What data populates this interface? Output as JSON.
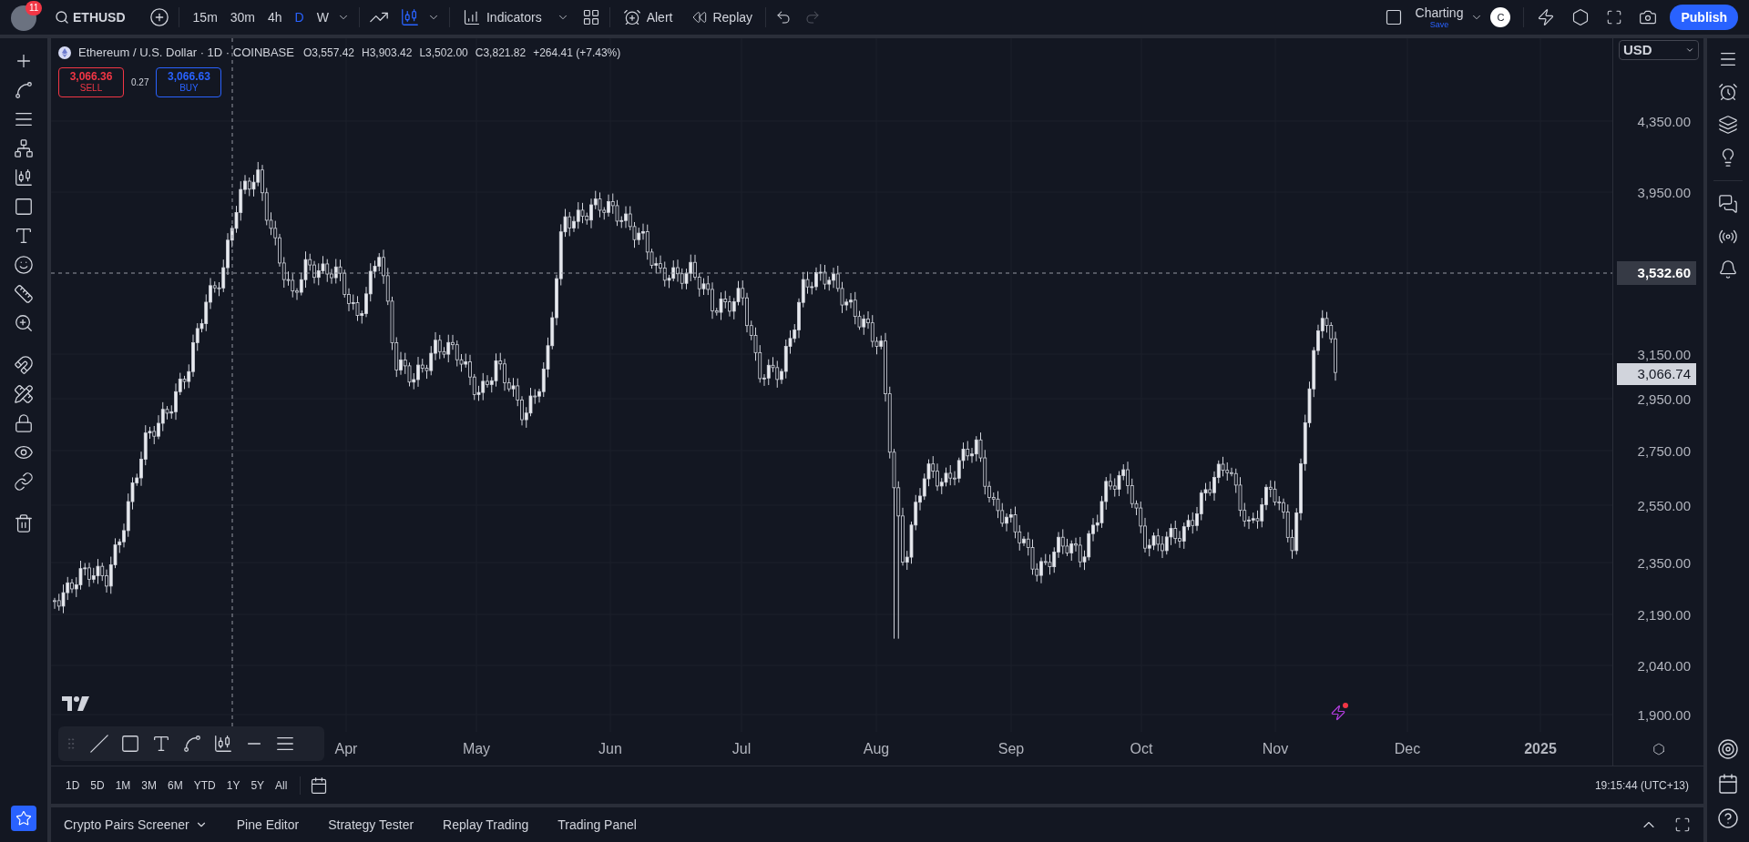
{
  "top_bar": {
    "notification_count": "11",
    "symbol": "ETHUSD",
    "intervals": [
      {
        "label": "15m",
        "selected": false
      },
      {
        "label": "30m",
        "selected": false
      },
      {
        "label": "4h",
        "selected": false
      },
      {
        "label": "D",
        "selected": true
      },
      {
        "label": "W",
        "selected": false
      }
    ],
    "indicators": "Indicators",
    "alert": "Alert",
    "replay": "Replay",
    "layout": {
      "name": "Charting",
      "status": "Save"
    },
    "user_initial": "C",
    "publish": "Publish"
  },
  "chart": {
    "instrument": "Ethereum / U.S. Dollar · 1D · COINBASE",
    "ohlc": [
      "O3,557.42",
      "H3,903.42",
      "L3,502.00",
      "C3,821.82"
    ],
    "change": "+264.41 (+7.43%)",
    "sell": {
      "price": "3,066.36",
      "label": "SELL"
    },
    "spread": "0.27",
    "buy": {
      "price": "3,066.63",
      "label": "BUY"
    },
    "currency": "USD",
    "price_ticks": [
      "4,350.00",
      "3,950.00",
      "3,150.00",
      "2,950.00",
      "2,750.00",
      "2,550.00",
      "2,350.00",
      "2,190.00",
      "2,040.00",
      "1,900.00"
    ],
    "crosshair_price": "3,532.60",
    "last_price": "3,066.74",
    "time_ticks": [
      {
        "label": "Apr",
        "kind": "month"
      },
      {
        "label": "May",
        "kind": "month"
      },
      {
        "label": "Jun",
        "kind": "month"
      },
      {
        "label": "Jul",
        "kind": "month"
      },
      {
        "label": "Aug",
        "kind": "month"
      },
      {
        "label": "Sep",
        "kind": "month"
      },
      {
        "label": "Oct",
        "kind": "month"
      },
      {
        "label": "Nov",
        "kind": "month"
      },
      {
        "label": "Dec",
        "kind": "month"
      },
      {
        "label": "2025",
        "kind": "year"
      }
    ]
  },
  "range_bar": {
    "ranges": [
      "1D",
      "5D",
      "1M",
      "3M",
      "6M",
      "YTD",
      "1Y",
      "5Y",
      "All"
    ],
    "clock": "19:15:44 (UTC+13)"
  },
  "bottom_panel": {
    "tabs": [
      "Crypto Pairs Screener",
      "Pine Editor",
      "Strategy Tester",
      "Replay Trading",
      "Trading Panel"
    ]
  }
}
